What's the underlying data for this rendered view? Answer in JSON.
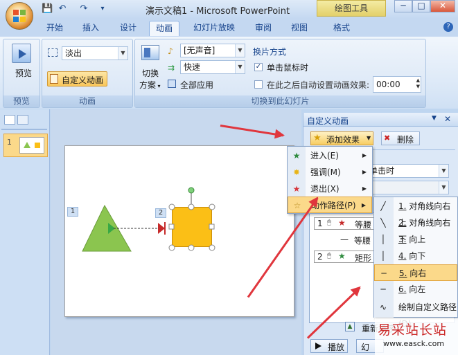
{
  "window": {
    "title": "演示文稿1 - Microsoft PowerPoint",
    "tool_tab": "绘图工具"
  },
  "qat": {
    "save": "💾",
    "undo": "↶",
    "redo": "↷",
    "customize": "▾"
  },
  "win_buttons": {
    "min": "─",
    "max": "□",
    "close": "✕"
  },
  "tabs": [
    "开始",
    "插入",
    "设计",
    "动画",
    "幻灯片放映",
    "审阅",
    "视图",
    "格式"
  ],
  "help": "?",
  "ribbon": {
    "preview": {
      "button": "预览",
      "group": "预览"
    },
    "animation": {
      "effect_value": "淡出",
      "custom_button": "自定义动画",
      "group": "动画"
    },
    "transition": {
      "switch_label1": "切换",
      "switch_label2": "方案",
      "sound_value": "[无声音]",
      "speed_value": "快速",
      "apply_all": "全部应用",
      "mode_title": "换片方式",
      "on_click": "单击鼠标时",
      "after_label": "在此之后自动设置动画效果:",
      "after_value": "00:00",
      "group": "切换到此幻灯片"
    }
  },
  "slides_panel": {
    "thumb_number": "1"
  },
  "slide": {
    "triangle_tag": "1",
    "square_tag": "2"
  },
  "task_pane": {
    "title": "自定义动画",
    "add_effect": "添加效果",
    "remove": "删除",
    "start_value": "单击时",
    "list": [
      {
        "num": "1",
        "name": "等腰"
      },
      {
        "num": "",
        "name": "等腰"
      },
      {
        "num": "2",
        "name": "矩形"
      }
    ],
    "reorder": "重新排序",
    "play": "播放",
    "slideshow": "幻"
  },
  "add_effect_menu": [
    {
      "label": "进入(E)",
      "color": "#2e8b3e"
    },
    {
      "label": "强调(M)",
      "color": "#e8b417"
    },
    {
      "label": "退出(X)",
      "color": "#d6363c"
    },
    {
      "label": "动作路径(P)",
      "color": "#f0f0f0"
    }
  ],
  "path_menu": [
    {
      "num": "1.",
      "text": "对角线向右上",
      "icon": "╱"
    },
    {
      "num": "2.",
      "text": "对角线向右下",
      "icon": "╲"
    },
    {
      "num": "3.",
      "text": "向上",
      "icon": "│"
    },
    {
      "num": "4.",
      "text": "向下",
      "icon": "│"
    },
    {
      "num": "5.",
      "text": "向右",
      "icon": "─"
    },
    {
      "num": "6.",
      "text": "向左",
      "icon": "─"
    },
    {
      "num": "",
      "text": "绘制自定义路径(D)",
      "icon": "∿"
    }
  ],
  "watermark": {
    "text": "易采站长站",
    "url": "www.easck.com"
  },
  "colors": {
    "accent": "#15428b",
    "highlight": "#fbd98a",
    "arrow": "#e0363d",
    "triangle": "#8bc54f",
    "square": "#fbbf16"
  }
}
